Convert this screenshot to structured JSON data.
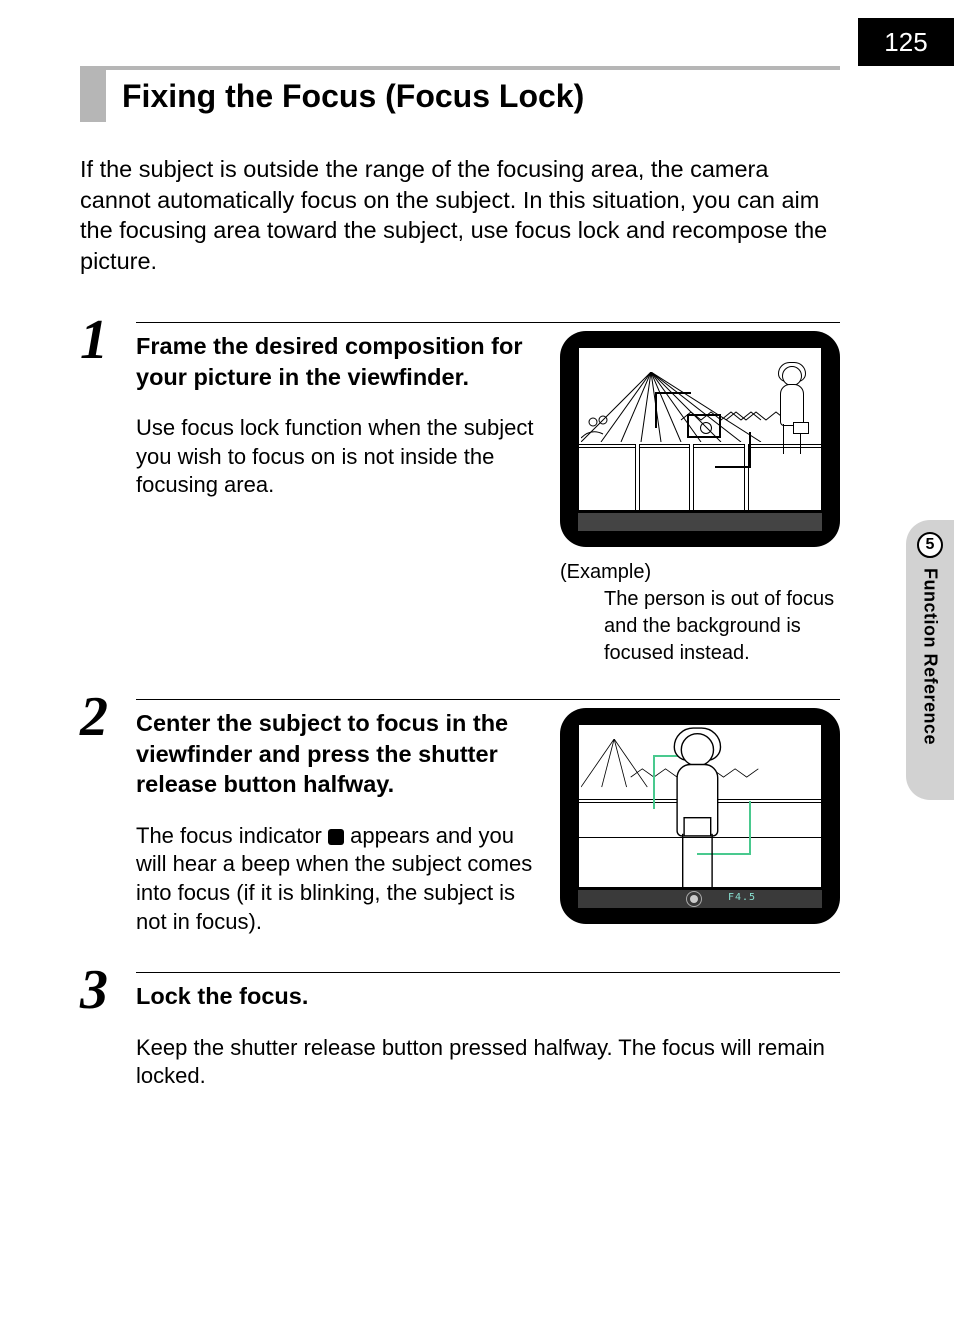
{
  "page_number": "125",
  "side_tab": {
    "number": "5",
    "label": "Function Reference"
  },
  "title": "Fixing the Focus (Focus Lock)",
  "intro": "If the subject is outside the range of the focusing area, the camera cannot automatically focus on the subject. In this situation, you can aim the focusing area toward the subject, use focus lock and recompose the picture.",
  "steps": [
    {
      "num": "1",
      "heading": "Frame the desired composition for your picture in the viewfinder.",
      "para": "Use focus lock function when the subject you wish to focus on is not inside the focusing area.",
      "example_label": "(Example)",
      "example_desc": "The person is out of focus and the background is focused instead."
    },
    {
      "num": "2",
      "heading": "Center the subject to focus in the viewfinder and press the shutter release button halfway.",
      "para_pre": "The focus indicator ",
      "para_post": " appears and you will hear a beep when the subject comes into focus (if it is blinking, the subject is not in focus).",
      "status_text": "F4.5"
    },
    {
      "num": "3",
      "heading": "Lock the focus.",
      "para": "Keep the shutter release button pressed halfway. The focus will remain locked."
    }
  ]
}
